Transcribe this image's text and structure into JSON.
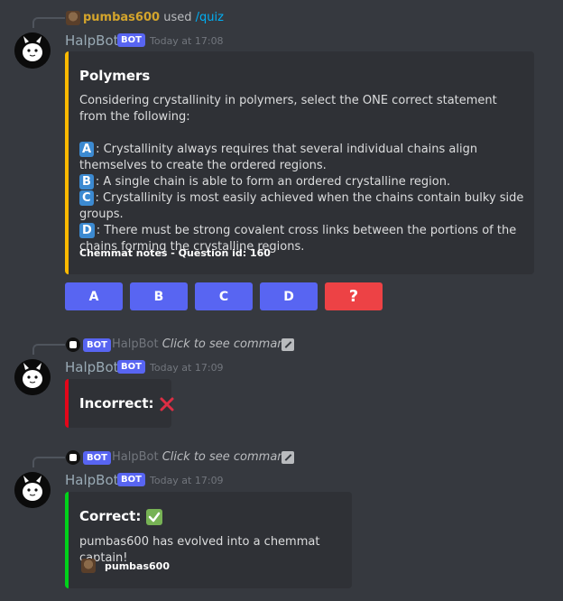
{
  "msg1": {
    "reply": {
      "user": "pumbas600",
      "used": "used",
      "command": "/quiz"
    },
    "author": "HalpBot",
    "bot_tag": "BOT",
    "timestamp": "Today at 17:08",
    "embed": {
      "title": "Polymers",
      "question": "Considering crystallinity in polymers, select the ONE correct statement from the following:",
      "options": [
        {
          "letter": "A",
          "text": ": Crystallinity always requires that several individual chains align themselves to create the ordered regions."
        },
        {
          "letter": "B",
          "text": ": A single chain is able to form an ordered crystalline region."
        },
        {
          "letter": "C",
          "text": ": Crystallinity is most easily achieved when the chains contain bulky side groups."
        },
        {
          "letter": "D",
          "text": ": There must be strong covalent cross links between the portions of the chains forming the crystalline regions."
        }
      ],
      "footer": "Chemmat notes - Question id: 160",
      "accent": "#fcb900"
    },
    "buttons": [
      "A",
      "B",
      "C",
      "D",
      "?"
    ]
  },
  "msg2": {
    "reply": {
      "bot_tag": "BOT",
      "user": "HalpBot",
      "text": "Click to see command"
    },
    "author": "HalpBot",
    "bot_tag": "BOT",
    "timestamp": "Today at 17:09",
    "embed": {
      "title": "Incorrect:",
      "accent": "#e3061a",
      "icon": "cross-icon"
    }
  },
  "msg3": {
    "reply": {
      "bot_tag": "BOT",
      "user": "HalpBot",
      "text": "Click to see command"
    },
    "author": "HalpBot",
    "bot_tag": "BOT",
    "timestamp": "Today at 17:09",
    "embed": {
      "title": "Correct:",
      "description": "pumbas600 has evolved into a chemmat captain!",
      "footer_user": "pumbas600",
      "accent": "#00d21a",
      "icon": "check-icon"
    }
  },
  "colors": {
    "blurple": "#5865f2",
    "danger": "#ed4245",
    "background": "#36393f",
    "embed_bg": "#2f3136"
  }
}
